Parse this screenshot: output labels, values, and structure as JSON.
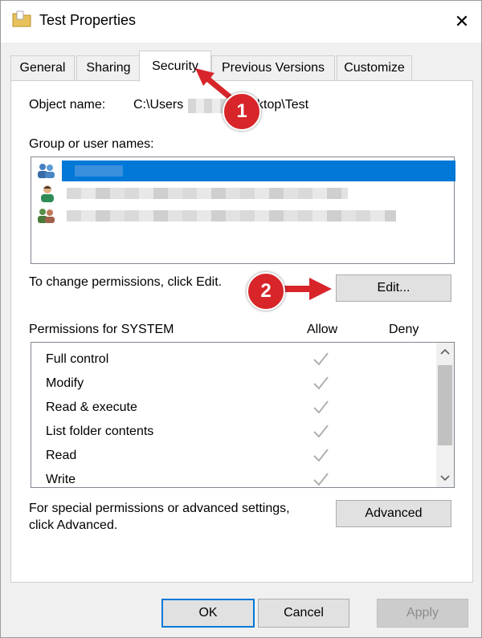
{
  "window": {
    "title": "Test Properties",
    "close_glyph": "✕"
  },
  "tabs": [
    {
      "label": "General"
    },
    {
      "label": "Sharing"
    },
    {
      "label": "Security"
    },
    {
      "label": "Previous Versions"
    },
    {
      "label": "Customize"
    }
  ],
  "active_tab": "Security",
  "object": {
    "label": "Object name:",
    "value_prefix": "C:\\Users",
    "value_suffix": "ktop\\Test"
  },
  "groups": {
    "label": "Group or user names:",
    "items": [
      {
        "icon": "user-group-icon",
        "selected": true
      },
      {
        "icon": "user-icon",
        "selected": false
      },
      {
        "icon": "user-group-icon",
        "selected": false
      }
    ]
  },
  "change_text": "To change permissions, click Edit.",
  "edit_button": "Edit...",
  "permissions": {
    "label": "Permissions for SYSTEM",
    "allow_header": "Allow",
    "deny_header": "Deny",
    "items": [
      {
        "name": "Full control",
        "allow": true
      },
      {
        "name": "Modify",
        "allow": true
      },
      {
        "name": "Read & execute",
        "allow": true
      },
      {
        "name": "List folder contents",
        "allow": true
      },
      {
        "name": "Read",
        "allow": true
      },
      {
        "name": "Write",
        "allow": true
      }
    ]
  },
  "special": {
    "line1": "For special permissions or advanced settings,",
    "line2": "click Advanced."
  },
  "advanced_button": "Advanced",
  "footer": {
    "ok": "OK",
    "cancel": "Cancel",
    "apply": "Apply"
  },
  "annotations": {
    "step1": "1",
    "step2": "2",
    "color": "#d7252a"
  }
}
